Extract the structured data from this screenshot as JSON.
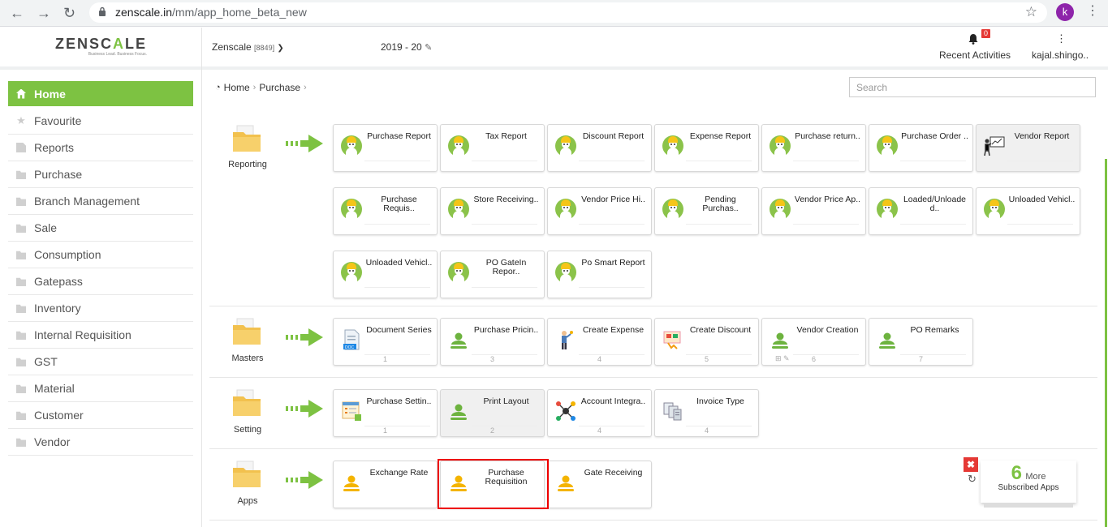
{
  "browser": {
    "url_host": "zenscale.in",
    "url_path": "/mm/app_home_beta_new",
    "profile_initial": "k"
  },
  "header": {
    "logo_text": "ZENSCALE",
    "logo_tagline": "Business Lead. Business Focus.",
    "company": "Zenscale",
    "company_id": "[8849]",
    "fiscal_year": "2019 - 20",
    "notification_count": "0",
    "recent_activities": "Recent Activities",
    "user": "kajal.shingo.."
  },
  "sidebar": {
    "items": [
      {
        "label": "Home",
        "icon": "home-icon"
      },
      {
        "label": "Favourite",
        "icon": "star-icon"
      },
      {
        "label": "Reports",
        "icon": "document-icon"
      },
      {
        "label": "Purchase",
        "icon": "folder-icon"
      },
      {
        "label": "Branch Management",
        "icon": "folder-icon"
      },
      {
        "label": "Sale",
        "icon": "folder-icon"
      },
      {
        "label": "Consumption",
        "icon": "folder-icon"
      },
      {
        "label": "Gatepass",
        "icon": "folder-icon"
      },
      {
        "label": "Inventory",
        "icon": "folder-icon"
      },
      {
        "label": "Internal Requisition",
        "icon": "folder-icon"
      },
      {
        "label": "GST",
        "icon": "folder-icon"
      },
      {
        "label": "Material",
        "icon": "folder-icon"
      },
      {
        "label": "Customer",
        "icon": "folder-icon"
      },
      {
        "label": "Vendor",
        "icon": "folder-icon"
      }
    ]
  },
  "breadcrumb": {
    "home": "Home",
    "current": "Purchase"
  },
  "search": {
    "placeholder": "Search"
  },
  "sections": {
    "reporting": {
      "label": "Reporting",
      "tiles": [
        {
          "title": "Purchase Report"
        },
        {
          "title": "Tax Report"
        },
        {
          "title": "Discount Report"
        },
        {
          "title": "Expense Report"
        },
        {
          "title": "Purchase return.."
        },
        {
          "title": "Purchase Order .."
        },
        {
          "title": "Vendor Report"
        },
        {
          "title": "Purchase Requis.."
        },
        {
          "title": "Store Receiving.."
        },
        {
          "title": "Vendor Price Hi.."
        },
        {
          "title": "Pending Purchas.."
        },
        {
          "title": "Vendor Price Ap.."
        },
        {
          "title": "Loaded/Unloade d.."
        },
        {
          "title": "Unloaded Vehicl.."
        },
        {
          "title": "Unloaded Vehicl.."
        },
        {
          "title": "PO GateIn Repor.."
        },
        {
          "title": "Po Smart Report"
        }
      ]
    },
    "masters": {
      "label": "Masters",
      "tiles": [
        {
          "title": "Document Series",
          "count": "1"
        },
        {
          "title": "Purchase Pricin..",
          "count": "3"
        },
        {
          "title": "Create Expense",
          "count": "4"
        },
        {
          "title": "Create Discount",
          "count": "5"
        },
        {
          "title": "Vendor Creation",
          "count": "6"
        },
        {
          "title": "PO Remarks",
          "count": "7"
        }
      ]
    },
    "setting": {
      "label": "Setting",
      "tiles": [
        {
          "title": "Purchase Settin..",
          "count": "1"
        },
        {
          "title": "Print Layout",
          "count": "2"
        },
        {
          "title": "Account Integra..",
          "count": "4"
        },
        {
          "title": "Invoice Type",
          "count": "4"
        }
      ]
    },
    "apps": {
      "label": "Apps",
      "tiles": [
        {
          "title": "Exchange Rate"
        },
        {
          "title": "Purchase Requisition"
        },
        {
          "title": "Gate Receiving"
        }
      ]
    }
  },
  "more_apps": {
    "count": "6",
    "label": "More",
    "sub": "Subscribed Apps"
  },
  "colors": {
    "accent": "#7dc242",
    "alert": "#e53935",
    "highlight": "#e00000"
  }
}
